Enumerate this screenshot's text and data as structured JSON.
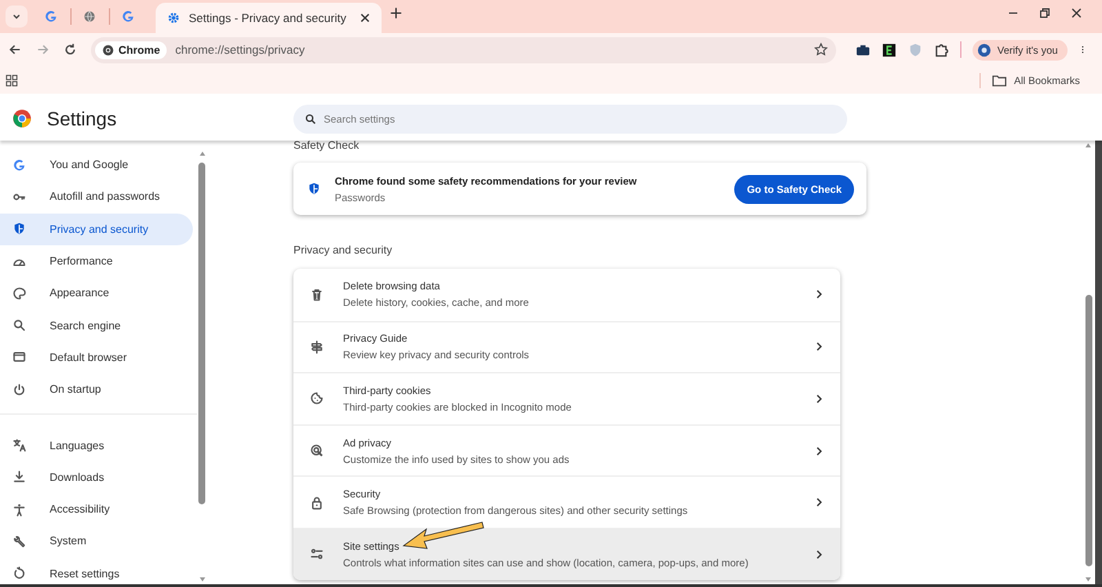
{
  "tab_strip": {
    "tabs": [
      {
        "kind": "google",
        "selected": false
      },
      {
        "kind": "globe",
        "selected": false
      },
      {
        "kind": "google",
        "selected": false
      },
      {
        "kind": "gear",
        "title": "Settings - Privacy and security",
        "selected": true
      }
    ]
  },
  "toolbar": {
    "chip": "Chrome",
    "url": "chrome://settings/privacy",
    "profile_button": "Verify it's you"
  },
  "bookmarks_bar": {
    "all_bookmarks": "All Bookmarks"
  },
  "header": {
    "title": "Settings",
    "search": {
      "placeholder": "Search settings"
    }
  },
  "sidebar": {
    "sections": [
      {
        "items": [
          {
            "kind": "google",
            "label": "You and Google",
            "selected": false
          },
          {
            "kind": "key",
            "label": "Autofill and passwords",
            "selected": false
          },
          {
            "kind": "shield",
            "label": "Privacy and security",
            "selected": true
          },
          {
            "kind": "gauge",
            "label": "Performance",
            "selected": false
          },
          {
            "kind": "palette",
            "label": "Appearance",
            "selected": false
          },
          {
            "kind": "search",
            "label": "Search engine",
            "selected": false
          },
          {
            "kind": "window",
            "label": "Default browser",
            "selected": false
          },
          {
            "kind": "power",
            "label": "On startup",
            "selected": false
          }
        ]
      },
      {
        "items": [
          {
            "kind": "translate",
            "label": "Languages",
            "selected": false
          },
          {
            "kind": "download",
            "label": "Downloads",
            "selected": false
          },
          {
            "kind": "person",
            "label": "Accessibility",
            "selected": false
          },
          {
            "kind": "wrench",
            "label": "System",
            "selected": false
          },
          {
            "kind": "reset",
            "label": "Reset settings",
            "selected": false
          }
        ]
      }
    ]
  },
  "safety_check": {
    "heading": "Safety Check",
    "message": "Chrome found some safety recommendations for your review",
    "detail": "Passwords",
    "button": "Go to Safety Check"
  },
  "privacy_section": {
    "heading": "Privacy and security",
    "rows": [
      {
        "kind": "trash",
        "title": "Delete browsing data",
        "description": "Delete history, cookies, cache, and more",
        "highlighted": false
      },
      {
        "kind": "signpost",
        "title": "Privacy Guide",
        "description": "Review key privacy and security controls",
        "highlighted": false
      },
      {
        "kind": "cookie",
        "title": "Third-party cookies",
        "description": "Third-party cookies are blocked in Incognito mode",
        "highlighted": false
      },
      {
        "kind": "target",
        "title": "Ad privacy",
        "description": "Customize the info used by sites to show you ads",
        "highlighted": false
      },
      {
        "kind": "lock",
        "title": "Security",
        "description": "Safe Browsing (protection from dangerous sites) and other security settings",
        "highlighted": false
      },
      {
        "kind": "sliders",
        "title": "Site settings",
        "description": "Controls what information sites can use and show (location, camera, pop-ups, and more)",
        "highlighted": true
      }
    ]
  }
}
